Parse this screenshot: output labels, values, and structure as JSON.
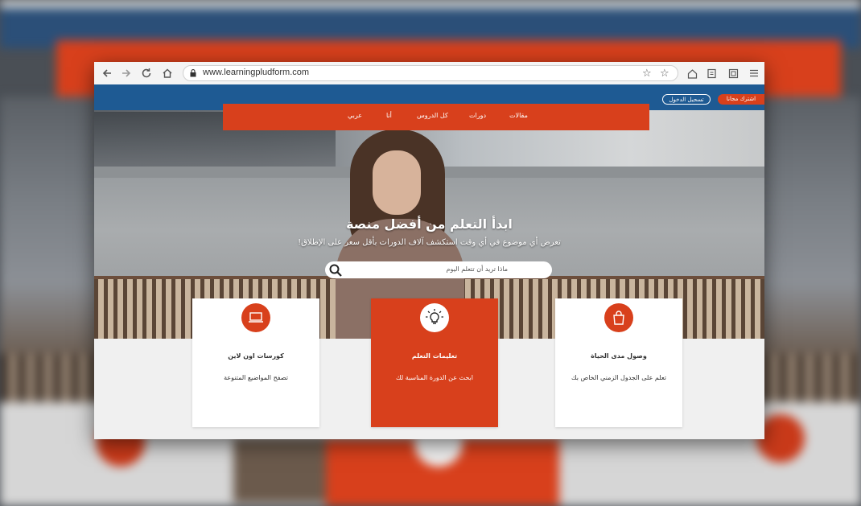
{
  "browser": {
    "url": "www.learningpludform.com"
  },
  "site": {
    "header": {
      "login_label": "تسجيل الدخول",
      "signup_label": "اشترك مجانا"
    },
    "nav": {
      "items": [
        "عربي",
        "أنا",
        "كل الدروس",
        "دورات",
        "مقالات"
      ]
    },
    "hero": {
      "title": "ابدأ التعلم من أفضل منصة",
      "subtitle": "تعرض أي موضوع في أي وقت استكشف آلاف الدورات بأقل سعر على الإطلاق!",
      "search_placeholder": "ماذا تريد أن تتعلم اليوم"
    },
    "cards": [
      {
        "title": "كورسات اون لاين",
        "text": "تصفح المواضيع المتنوعة",
        "icon": "laptop-icon",
        "active": false
      },
      {
        "title": "تعليمات التعلم",
        "text": "ابحث عن الدورة المناسبة لك",
        "icon": "lightbulb-icon",
        "active": true
      },
      {
        "title": "وصول مدى الحياة",
        "text": "تعلم على الجدول الزمني الخاص بك",
        "icon": "bag-icon",
        "active": false
      }
    ]
  },
  "colors": {
    "accent": "#d8401c",
    "header_blue": "#1e5a93"
  }
}
